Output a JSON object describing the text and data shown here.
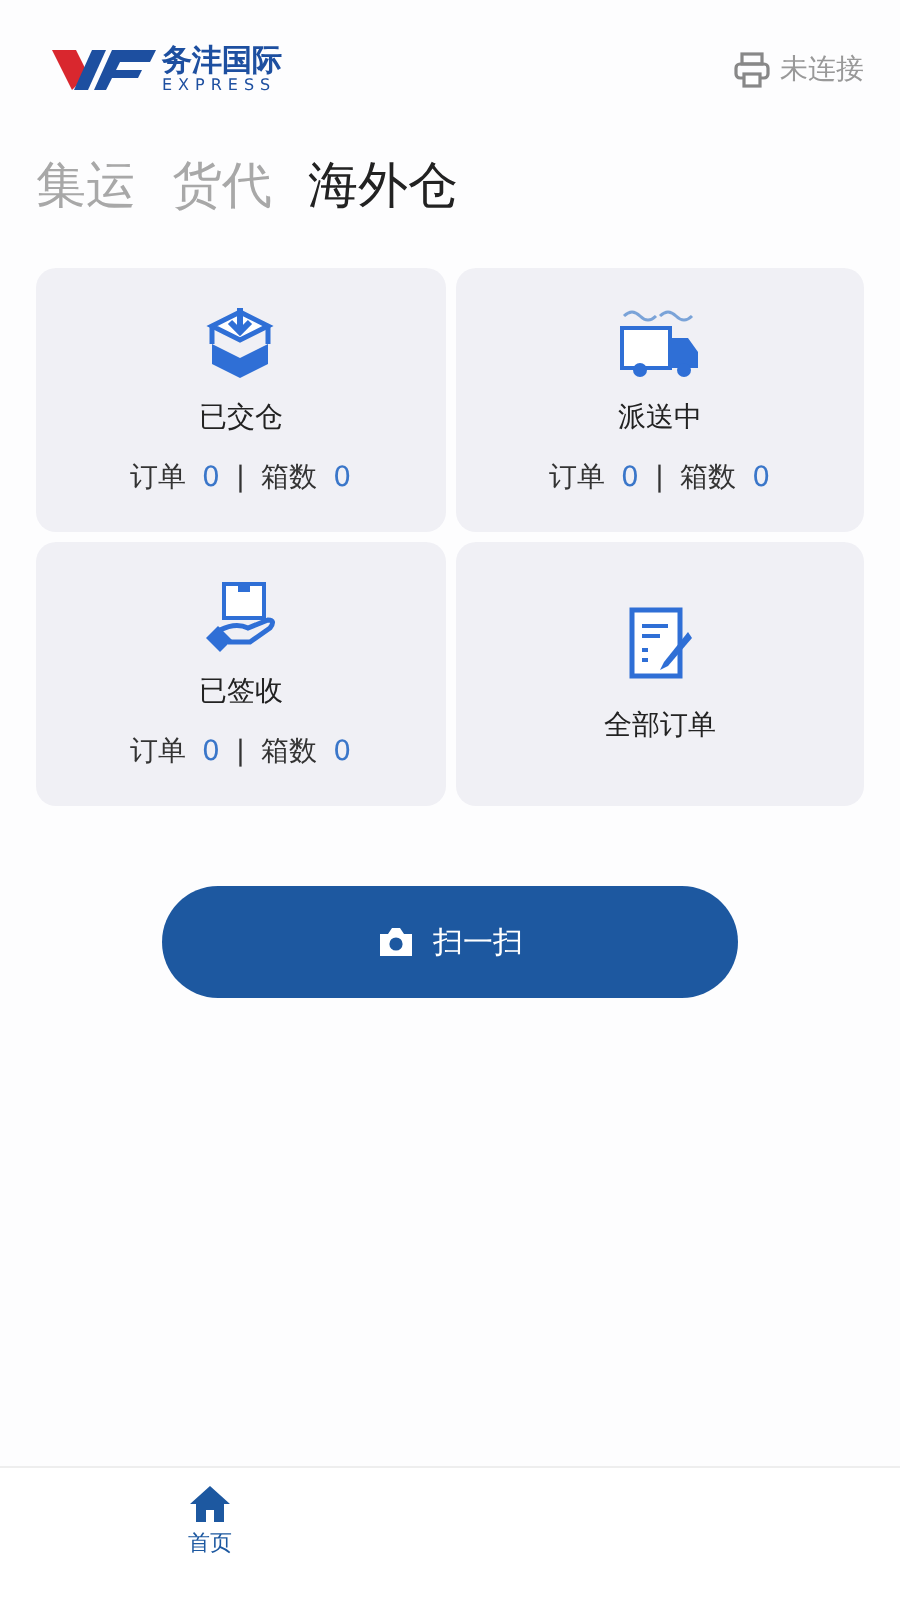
{
  "header": {
    "logo_text": "务沣国际",
    "logo_subtext": "EXPRESS",
    "printer_status": "未连接"
  },
  "tabs": [
    {
      "label": "集运",
      "selected": false
    },
    {
      "label": "货代",
      "selected": false
    },
    {
      "label": "海外仓",
      "selected": true
    }
  ],
  "cards": [
    {
      "kind": "stats",
      "title": "已交仓",
      "order_label": "订单",
      "order_count": "0",
      "separator": "|",
      "box_label": "箱数",
      "box_count": "0"
    },
    {
      "kind": "stats",
      "title": "派送中",
      "order_label": "订单",
      "order_count": "0",
      "separator": "|",
      "box_label": "箱数",
      "box_count": "0"
    },
    {
      "kind": "stats",
      "title": "已签收",
      "order_label": "订单",
      "order_count": "0",
      "separator": "|",
      "box_label": "箱数",
      "box_count": "0"
    },
    {
      "kind": "link",
      "title": "全部订单"
    }
  ],
  "scan_button": {
    "label": "扫一扫"
  },
  "bottom_nav": [
    {
      "label": "首页",
      "selected": true
    }
  ]
}
